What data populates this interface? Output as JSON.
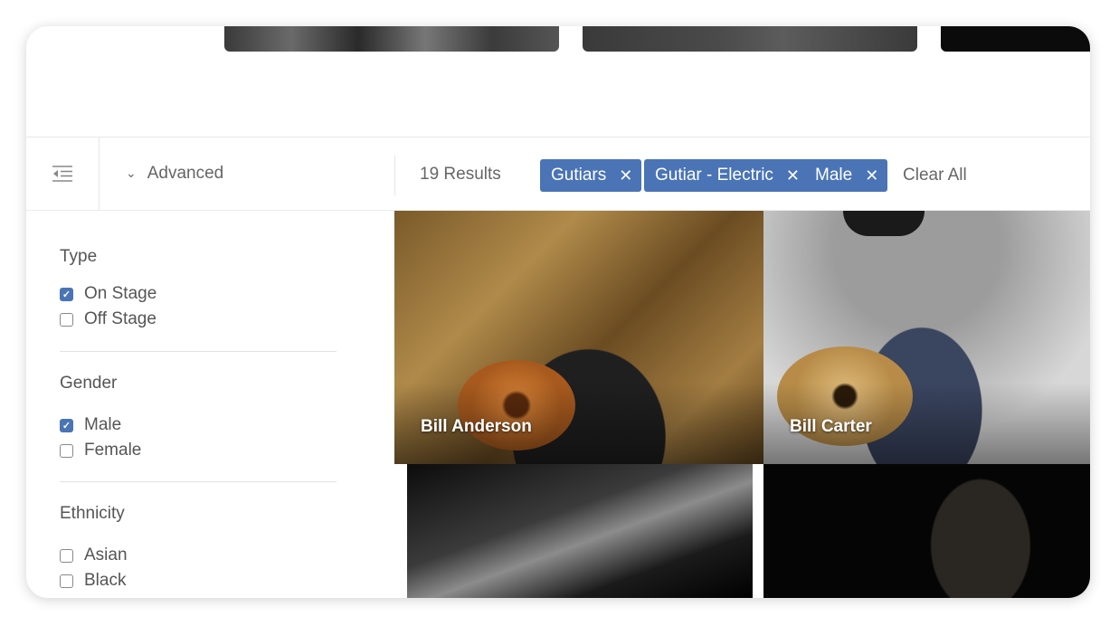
{
  "toolbar": {
    "collapse_icon": "indent-menu-icon",
    "advanced_label": "Advanced",
    "results_label": "19 Results",
    "filters": [
      {
        "label": "Gutiars"
      },
      {
        "label": "Gutiar - Electric"
      },
      {
        "label": "Male"
      }
    ],
    "clear_all_label": "Clear All"
  },
  "sidebar": {
    "type": {
      "title": "Type",
      "options": [
        {
          "label": "On Stage",
          "checked": true
        },
        {
          "label": "Off Stage",
          "checked": false
        }
      ]
    },
    "gender": {
      "title": "Gender",
      "options": [
        {
          "label": "Male",
          "checked": true
        },
        {
          "label": "Female",
          "checked": false
        }
      ]
    },
    "ethnicity": {
      "title": "Ethnicity",
      "options": [
        {
          "label": "Asian",
          "checked": false
        },
        {
          "label": "Black",
          "checked": false
        }
      ]
    }
  },
  "results": [
    {
      "name": "Bill Anderson"
    },
    {
      "name": "Bill Carter"
    },
    {
      "name": ""
    },
    {
      "name": ""
    }
  ],
  "colors": {
    "accent": "#4a74b5",
    "text": "#555555"
  }
}
